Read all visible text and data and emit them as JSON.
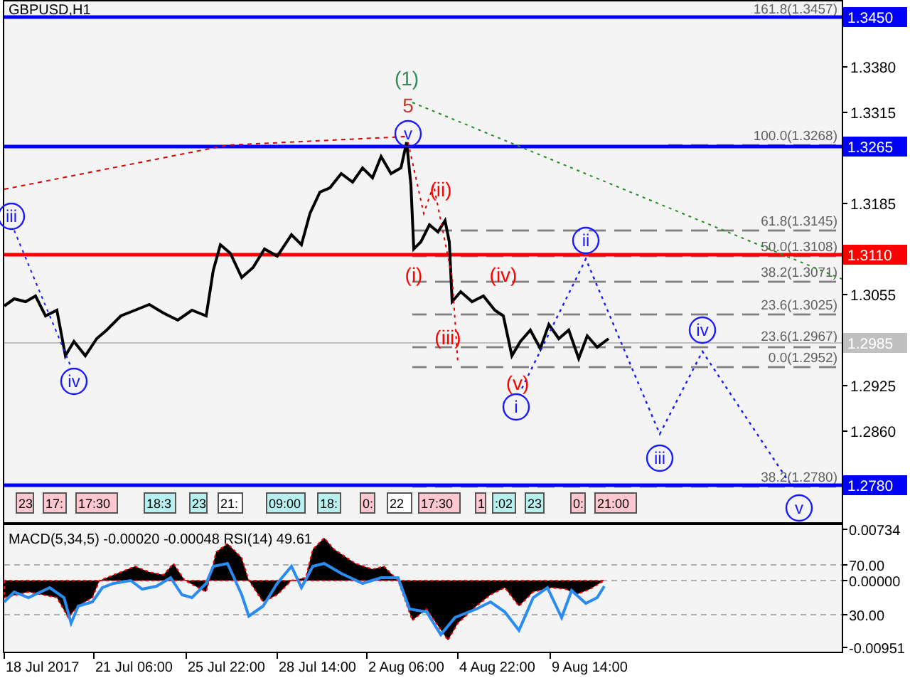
{
  "chart": {
    "title": "GBPUSD,H1",
    "price_axis": [
      "1.3380",
      "1.3315",
      "1.3185",
      "1.3055",
      "1.2925",
      "1.2860"
    ],
    "price_levels": [
      {
        "label": "1.3450",
        "color": "#0000ff"
      },
      {
        "label": "1.3265",
        "color": "#0000ff"
      },
      {
        "label": "1.3110",
        "color": "#ff0000"
      },
      {
        "label": "1.2985",
        "color": "#c0c0c0"
      },
      {
        "label": "1.2780",
        "color": "#0000ff"
      }
    ],
    "fib_levels": [
      "161.8(1.3457)",
      "100.0(1.3268)",
      "61.8(1.3145)",
      "50.0(1.3108)",
      "38.2(1.3071)",
      "23.6(1.3025)",
      "23.6(1.2967)",
      "0.0(1.2952)",
      "38.2(1.2780)"
    ],
    "wave_labels": [
      {
        "text": "(1)",
        "kind": "plain",
        "color": "#2e8b57"
      },
      {
        "text": "5",
        "kind": "plain",
        "color": "#c0392b"
      },
      {
        "text": "v",
        "kind": "circled",
        "color": "#1a1aff"
      },
      {
        "text": "iii",
        "kind": "circled",
        "color": "#1a1aff"
      },
      {
        "text": "iv",
        "kind": "circled",
        "color": "#1a1aff"
      },
      {
        "text": "(ii)",
        "kind": "plain",
        "color": "#ff0000"
      },
      {
        "text": "(i)",
        "kind": "plain",
        "color": "#ff0000"
      },
      {
        "text": "(iii)",
        "kind": "plain",
        "color": "#ff0000"
      },
      {
        "text": "(iv)",
        "kind": "plain",
        "color": "#ff0000"
      },
      {
        "text": "(v)",
        "kind": "plain",
        "color": "#ff0000"
      },
      {
        "text": "i",
        "kind": "circled",
        "color": "#1a1aff"
      },
      {
        "text": "ii",
        "kind": "circled",
        "color": "#1a1aff"
      },
      {
        "text": "iv",
        "kind": "circled",
        "color": "#1a1aff"
      },
      {
        "text": "iii",
        "kind": "circled",
        "color": "#1a1aff"
      },
      {
        "text": "v",
        "kind": "circled",
        "color": "#1a1aff"
      }
    ],
    "event_tags": [
      {
        "text": "23",
        "color": "#ffc8d0"
      },
      {
        "text": "17:",
        "color": "#ffc8d0"
      },
      {
        "text": "17:30",
        "color": "#ffc8d0"
      },
      {
        "text": "18:3",
        "color": "#b8f0f0"
      },
      {
        "text": "23",
        "color": "#b8f0f0"
      },
      {
        "text": "21:",
        "color": "#ffffff"
      },
      {
        "text": "09:00",
        "color": "#b8f0f0"
      },
      {
        "text": "18:",
        "color": "#b8f0f0"
      },
      {
        "text": "0:",
        "color": "#ffc8d0"
      },
      {
        "text": "22",
        "color": "#ffffff"
      },
      {
        "text": "17:30",
        "color": "#ffc8d0"
      },
      {
        "text": "1",
        "color": "#ffc8d0"
      },
      {
        "text": ":02",
        "color": "#b8f0f0"
      },
      {
        "text": "23",
        "color": "#b8f0f0"
      },
      {
        "text": "0:",
        "color": "#ffc8d0"
      },
      {
        "text": "21:00",
        "color": "#ffc8d0"
      }
    ]
  },
  "indicator": {
    "label": "MACD(5,34,5) -0.00020 -0.00048 RSI(14) 49.61",
    "axis": [
      "0.00734",
      "70.00",
      "0.00000",
      "30.00",
      "-0.00951"
    ]
  },
  "time_axis": [
    "18 Jul 2017",
    "21 Jul 06:00",
    "25 Jul 22:00",
    "28 Jul 14:00",
    "2 Aug 06:00",
    "4 Aug 22:00",
    "9 Aug 14:00"
  ]
}
